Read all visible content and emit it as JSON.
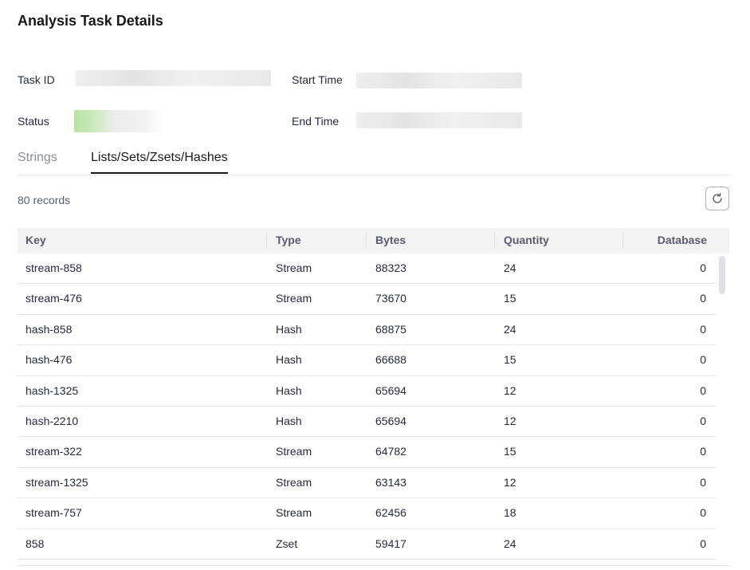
{
  "page": {
    "title": "Analysis Task Details"
  },
  "info": {
    "task_id_label": "Task ID",
    "start_time_label": "Start Time",
    "status_label": "Status",
    "end_time_label": "End Time"
  },
  "tabs": [
    {
      "label": "Strings",
      "active": false
    },
    {
      "label": "Lists/Sets/Zsets/Hashes",
      "active": true
    }
  ],
  "records_text": "80 records",
  "refresh_icon": "refresh-icon",
  "table": {
    "columns": [
      "Key",
      "Type",
      "Bytes",
      "Quantity",
      "Database"
    ],
    "rows": [
      [
        "stream-858",
        "Stream",
        "88323",
        "24",
        "0"
      ],
      [
        "stream-476",
        "Stream",
        "73670",
        "15",
        "0"
      ],
      [
        "hash-858",
        "Hash",
        "68875",
        "24",
        "0"
      ],
      [
        "hash-476",
        "Hash",
        "66688",
        "15",
        "0"
      ],
      [
        "hash-1325",
        "Hash",
        "65694",
        "12",
        "0"
      ],
      [
        "hash-2210",
        "Hash",
        "65694",
        "12",
        "0"
      ],
      [
        "stream-322",
        "Stream",
        "64782",
        "15",
        "0"
      ],
      [
        "stream-1325",
        "Stream",
        "63143",
        "12",
        "0"
      ],
      [
        "stream-757",
        "Stream",
        "62456",
        "18",
        "0"
      ],
      [
        "858",
        "Zset",
        "59417",
        "24",
        "0"
      ]
    ]
  }
}
